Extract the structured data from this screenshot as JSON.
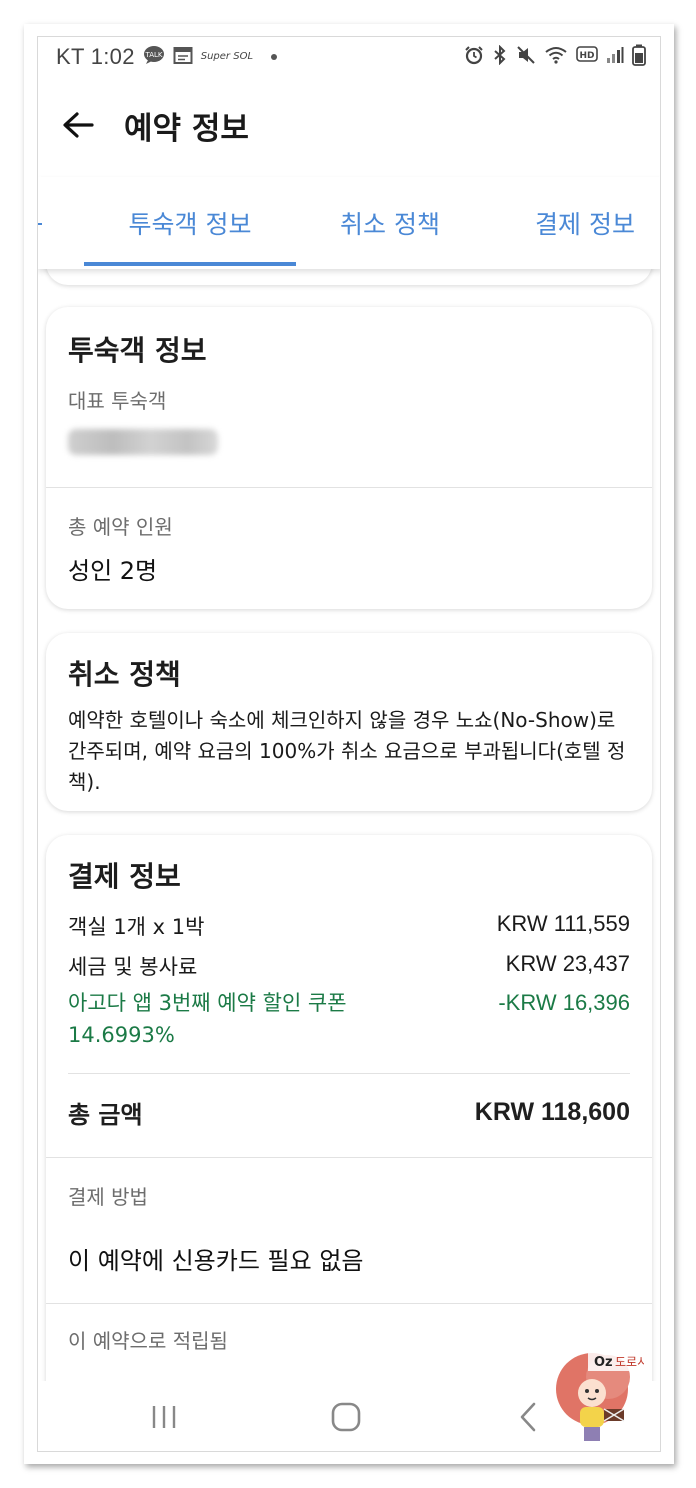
{
  "status_bar": {
    "carrier_time": "KT 1:02",
    "talk_badge": "TALK",
    "super_sol": "Super SOL",
    "icons": [
      "chat-icon",
      "calendar-icon",
      "alarm-icon",
      "bluetooth-icon",
      "mute-icon",
      "wifi-icon",
      "hd-icon",
      "signal-icon",
      "battery-icon"
    ]
  },
  "app_bar": {
    "title": "예약 정보"
  },
  "tabs": [
    {
      "label": "투숙객 정보",
      "active": true
    },
    {
      "label": "취소 정책",
      "active": false
    },
    {
      "label": "결제 정보",
      "active": false
    }
  ],
  "guest_card": {
    "title": "투숙객 정보",
    "primary_guest_label": "대표 투숙객",
    "total_guests_label": "총 예약 인원",
    "total_guests_value": "성인 2명"
  },
  "cancel_card": {
    "title": "취소 정책",
    "text": "예약한 호텔이나 숙소에 체크인하지 않을 경우 노쇼(No-Show)로 간주되며, 예약 요금의 100%가 취소 요금으로 부과됩니다(호텔 정책)."
  },
  "payment_card": {
    "title": "결제 정보",
    "lines": [
      {
        "label": "객실 1개 x 1박",
        "amount": "KRW 111,559"
      },
      {
        "label": "세금 및 봉사료",
        "amount": "KRW 23,437"
      }
    ],
    "discount": {
      "label": "아고다 앱 3번째 예약 할인 쿠폰 14.6993%",
      "amount": "-KRW 16,396"
    },
    "total_label": "총 금액",
    "total_amount": "KRW 118,600",
    "method_label": "결제 방법",
    "method_value": "이 예약에 신용카드 필요 없음",
    "earned_label": "이 예약으로 적립됨"
  },
  "watermark": {
    "text": "Oz 도로시"
  },
  "colors": {
    "accent": "#4a88d6",
    "discount": "#1b7a46"
  }
}
